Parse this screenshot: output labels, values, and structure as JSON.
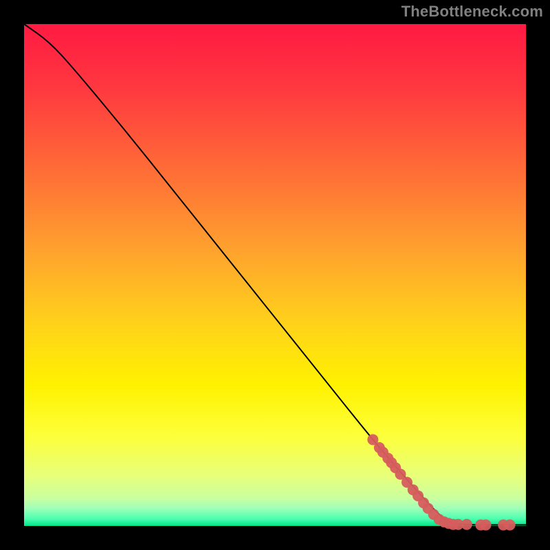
{
  "attribution": "TheBottleneck.com",
  "chart_data": {
    "type": "line",
    "title": "",
    "xlabel": "",
    "ylabel": "",
    "xlim": [
      0,
      100
    ],
    "ylim": [
      0,
      100
    ],
    "curve": {
      "name": "bottleneck-curve",
      "points": [
        {
          "x": 0.0,
          "y": 100.0
        },
        {
          "x": 5.0,
          "y": 96.5
        },
        {
          "x": 10.0,
          "y": 91.0
        },
        {
          "x": 20.0,
          "y": 79.0
        },
        {
          "x": 30.0,
          "y": 66.5
        },
        {
          "x": 40.0,
          "y": 54.0
        },
        {
          "x": 50.0,
          "y": 41.5
        },
        {
          "x": 60.0,
          "y": 29.0
        },
        {
          "x": 70.0,
          "y": 16.5
        },
        {
          "x": 80.0,
          "y": 5.0
        },
        {
          "x": 84.0,
          "y": 1.0
        },
        {
          "x": 86.0,
          "y": 0.3
        },
        {
          "x": 90.0,
          "y": 0.2
        },
        {
          "x": 95.0,
          "y": 0.2
        },
        {
          "x": 100.0,
          "y": 0.2
        }
      ]
    },
    "series": [
      {
        "name": "data-points",
        "color": "#d65d5d",
        "points": [
          {
            "x": 69.5,
            "y": 17.2
          },
          {
            "x": 70.8,
            "y": 15.6
          },
          {
            "x": 71.5,
            "y": 14.7
          },
          {
            "x": 72.5,
            "y": 13.5
          },
          {
            "x": 73.2,
            "y": 12.6
          },
          {
            "x": 74.0,
            "y": 11.6
          },
          {
            "x": 75.0,
            "y": 10.3
          },
          {
            "x": 76.3,
            "y": 8.7
          },
          {
            "x": 77.5,
            "y": 7.2
          },
          {
            "x": 78.5,
            "y": 6.0
          },
          {
            "x": 79.6,
            "y": 4.6
          },
          {
            "x": 80.5,
            "y": 3.5
          },
          {
            "x": 81.6,
            "y": 2.3
          },
          {
            "x": 82.7,
            "y": 1.3
          },
          {
            "x": 83.7,
            "y": 0.8
          },
          {
            "x": 84.6,
            "y": 0.5
          },
          {
            "x": 85.5,
            "y": 0.3
          },
          {
            "x": 86.5,
            "y": 0.3
          },
          {
            "x": 88.2,
            "y": 0.3
          },
          {
            "x": 91.0,
            "y": 0.2
          },
          {
            "x": 92.0,
            "y": 0.2
          },
          {
            "x": 95.5,
            "y": 0.2
          },
          {
            "x": 96.8,
            "y": 0.2
          }
        ]
      }
    ]
  },
  "gradient": {
    "stops": [
      {
        "pos": 0.0,
        "color": "#ff1a42"
      },
      {
        "pos": 0.12,
        "color": "#ff3640"
      },
      {
        "pos": 0.3,
        "color": "#ff6f36"
      },
      {
        "pos": 0.45,
        "color": "#ffa22e"
      },
      {
        "pos": 0.6,
        "color": "#ffd31a"
      },
      {
        "pos": 0.72,
        "color": "#fff200"
      },
      {
        "pos": 0.82,
        "color": "#fdff3a"
      },
      {
        "pos": 0.9,
        "color": "#e8ff7a"
      },
      {
        "pos": 0.945,
        "color": "#c9ffa0"
      },
      {
        "pos": 0.965,
        "color": "#9fffb9"
      },
      {
        "pos": 0.985,
        "color": "#4fffb0"
      },
      {
        "pos": 1.0,
        "color": "#00e58a"
      }
    ]
  }
}
